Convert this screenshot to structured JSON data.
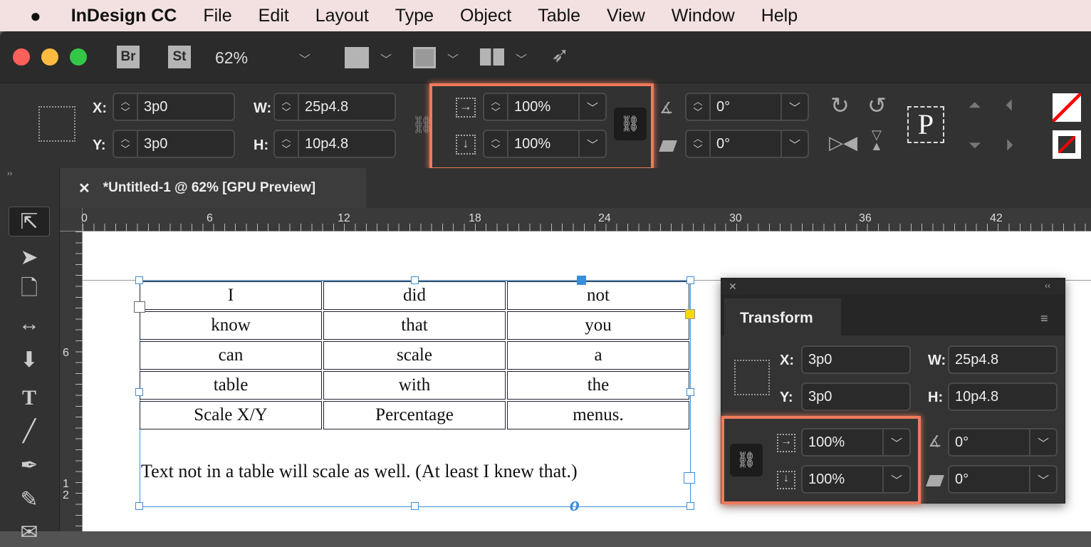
{
  "menubar": {
    "app": "InDesign CC",
    "items": [
      "File",
      "Edit",
      "Layout",
      "Type",
      "Object",
      "Table",
      "View",
      "Window",
      "Help"
    ]
  },
  "titlebar": {
    "bridge": "Br",
    "stock": "St",
    "zoom": "62%"
  },
  "control": {
    "x_label": "X:",
    "x": "3p0",
    "y_label": "Y:",
    "y": "3p0",
    "w_label": "W:",
    "w": "25p4.8",
    "h_label": "H:",
    "h": "10p4.8",
    "scale_x": "100%",
    "scale_y": "100%",
    "rotate": "0°",
    "shear": "0°",
    "p_glyph": "P"
  },
  "document_tab": {
    "title": "*Untitled-1 @ 62% [GPU Preview]"
  },
  "ruler": {
    "h_ticks": [
      "0",
      "6",
      "12",
      "18",
      "24",
      "30",
      "36",
      "42"
    ],
    "v_ticks": [
      "6",
      "1",
      "2"
    ]
  },
  "table": {
    "rows": [
      [
        "I",
        "did",
        "not"
      ],
      [
        "know",
        "that",
        "you"
      ],
      [
        "can",
        "scale",
        "a"
      ],
      [
        "table",
        "with",
        "the"
      ],
      [
        "Scale X/Y",
        "Percentage",
        "menus."
      ]
    ]
  },
  "body_text": "Text not in a table will scale as well. (At least I knew that.)",
  "transform_panel": {
    "title": "Transform",
    "x_label": "X:",
    "x": "3p0",
    "y_label": "Y:",
    "y": "3p0",
    "w_label": "W:",
    "w": "25p4.8",
    "h_label": "H:",
    "h": "10p4.8",
    "scale_x": "100%",
    "scale_y": "100%",
    "rotate": "0°",
    "shear": "0°"
  },
  "colors": {
    "highlight": "#ef7a5c",
    "selection": "#3b8ed8",
    "panel": "#323232"
  }
}
